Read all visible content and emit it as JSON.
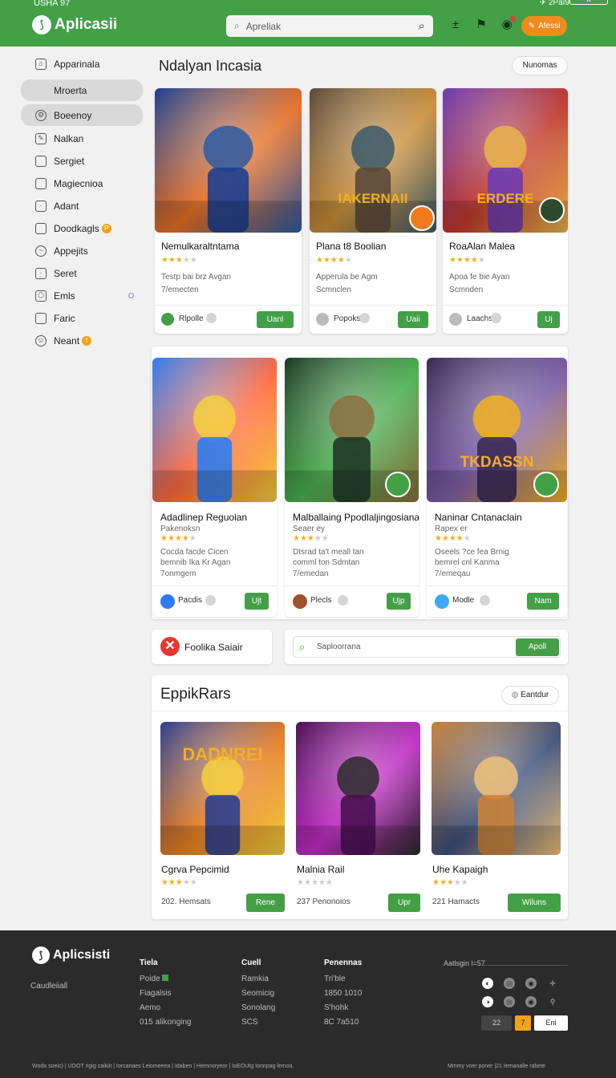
{
  "status": {
    "left": "USHA 97",
    "right": "✈ 2PaI9",
    "battery": "lll"
  },
  "header": {
    "app_name": "Aplicasii",
    "search_placeholder": "Apreliak",
    "action_label": "Afessi"
  },
  "sidebar": {
    "items": [
      {
        "label": "Apparinala",
        "active": false,
        "badge": ""
      },
      {
        "label": "Mroerta",
        "active": true,
        "badge": ""
      },
      {
        "label": "Boeenoy",
        "active": true,
        "badge": ""
      },
      {
        "label": "Nalkan",
        "active": false,
        "badge": ""
      },
      {
        "label": "Sergiet",
        "active": false,
        "badge": ""
      },
      {
        "label": "Magiecnioa",
        "active": false,
        "badge": ""
      },
      {
        "label": "Adant",
        "active": false,
        "badge": ""
      },
      {
        "label": "Doodkagls",
        "active": false,
        "badge": "P"
      },
      {
        "label": "Appejits",
        "active": false,
        "badge": ""
      },
      {
        "label": "Seret",
        "active": false,
        "badge": ""
      },
      {
        "label": "Emls",
        "active": false,
        "badge": ""
      },
      {
        "label": "Faric",
        "active": false,
        "badge": ""
      },
      {
        "label": "Neant",
        "active": false,
        "badge": "f"
      }
    ]
  },
  "section1": {
    "title": "Ndalyan Incasia",
    "pill": "Nunomas",
    "cards": [
      {
        "title": "Nemulkaraltntama",
        "rating": 3,
        "desc1": "Testp bai brz Avgan",
        "desc2": "7/emecten",
        "author": "Rlpolle",
        "button": "Uanl",
        "art_text": "",
        "colors": [
          "#1c3f8f",
          "#e76f24",
          "#2c5ba3"
        ]
      },
      {
        "title": "Plana t8 Boolian",
        "rating": 4,
        "desc1": "Apperula be Agm",
        "desc2": "Scmnclen",
        "author": "Popoks",
        "button": "Uaii",
        "art_text": "IAKERNAII",
        "colors": [
          "#5a4a3a",
          "#c98f3a",
          "#3b5a6b"
        ]
      },
      {
        "title": "RoaAlan Malea",
        "rating": 4,
        "desc1": "Apoa fe bie Ayan",
        "desc2": "Scmnden",
        "author": "Laachs",
        "button": "Uj",
        "art_text": "ERDERE",
        "colors": [
          "#6d3bb0",
          "#c0392b",
          "#e9b44c"
        ]
      }
    ]
  },
  "section2": {
    "cards": [
      {
        "title": "Adadlinep Reguoian",
        "subtitle": "Pakenoksn",
        "rating": 4,
        "desc1": "Cocda facde Cicen",
        "desc2": "bemnib Ika Kr Agan",
        "desc3": "7onmgem",
        "author": "Pacdis",
        "button": "Ujt",
        "art_text": "",
        "colors": [
          "#2f7cf0",
          "#ff6a3d",
          "#f4d03f"
        ]
      },
      {
        "title": "Malballaing Ppodlaljingosiana",
        "subtitle": "Seaer ey",
        "rating": 3,
        "desc1": "Dtsrad ta't meall tan",
        "desc2": "comml ton Sdmtan",
        "desc3": "7/emedan",
        "author": "Plecls",
        "button": "Ujp",
        "art_text": "",
        "colors": [
          "#1e3a26",
          "#4caf50",
          "#8d6e3f"
        ]
      },
      {
        "title": "Naninar Cntanaclain",
        "subtitle": "Rapex er",
        "rating": 4,
        "desc1": "Oseels ?ce fea Brnig",
        "desc2": "bemrel cnl Kanma",
        "desc3": "7/emeqau",
        "author": "Modle",
        "button": "Nam",
        "art_text": "TKDASSN",
        "colors": [
          "#3a2a55",
          "#7b5ea7",
          "#f2b01e"
        ]
      }
    ]
  },
  "notice": {
    "label": "Foolika Saiair",
    "search_placeholder": "Saploorrana",
    "button": "Apoll"
  },
  "section3": {
    "title": "EppikRars",
    "pill": "Eantdur",
    "cards": [
      {
        "title": "Cgrva Pepcimid",
        "rating": 3,
        "count": "202. Hemsats",
        "button": "Rene",
        "art_text": "DADNREI",
        "colors": [
          "#2c3e8f",
          "#e67e22",
          "#f4d03f"
        ]
      },
      {
        "title": "Malnia Rail",
        "rating": 0,
        "count": "237 Penonoios",
        "button": "Upr",
        "art_text": "",
        "colors": [
          "#4a1052",
          "#c02ec4",
          "#2b2b2b"
        ]
      },
      {
        "title": "Uhe Kapaigh",
        "rating": 3,
        "count": "221 Hamacts",
        "button": "Wiluns",
        "art_text": "",
        "colors": [
          "#c7823a",
          "#3d4f7a",
          "#f0c27b"
        ]
      }
    ]
  },
  "footer": {
    "app_name": "Aplicsisti",
    "tagline": "Caudleiiall",
    "columns": [
      {
        "title": "Tiela",
        "items": [
          "Poide",
          "Fiagalsis",
          "Aemo",
          "015 alikonging"
        ]
      },
      {
        "title": "Cuell",
        "items": [
          "Ramkia",
          "Seomicig",
          "Sonolang",
          "SCS"
        ]
      },
      {
        "title": "Penennas",
        "items": [
          "Tri'ble",
          "1850 1010",
          "S'hohk",
          "8C 7a510"
        ]
      }
    ],
    "social_title": "Aatlsgin l=57",
    "btn1": "22",
    "btn2": "7",
    "btn3": "Eni",
    "bottom_left": "Woda soeic) | UOOT rigig caikiit | Iorcanaes Leiomeeea | Idaben | Hemnoryeor | IoEOUtg Ionnpag lemoa.",
    "bottom_right": "Mmmy voer poner |21 Iemanalle rabete"
  }
}
